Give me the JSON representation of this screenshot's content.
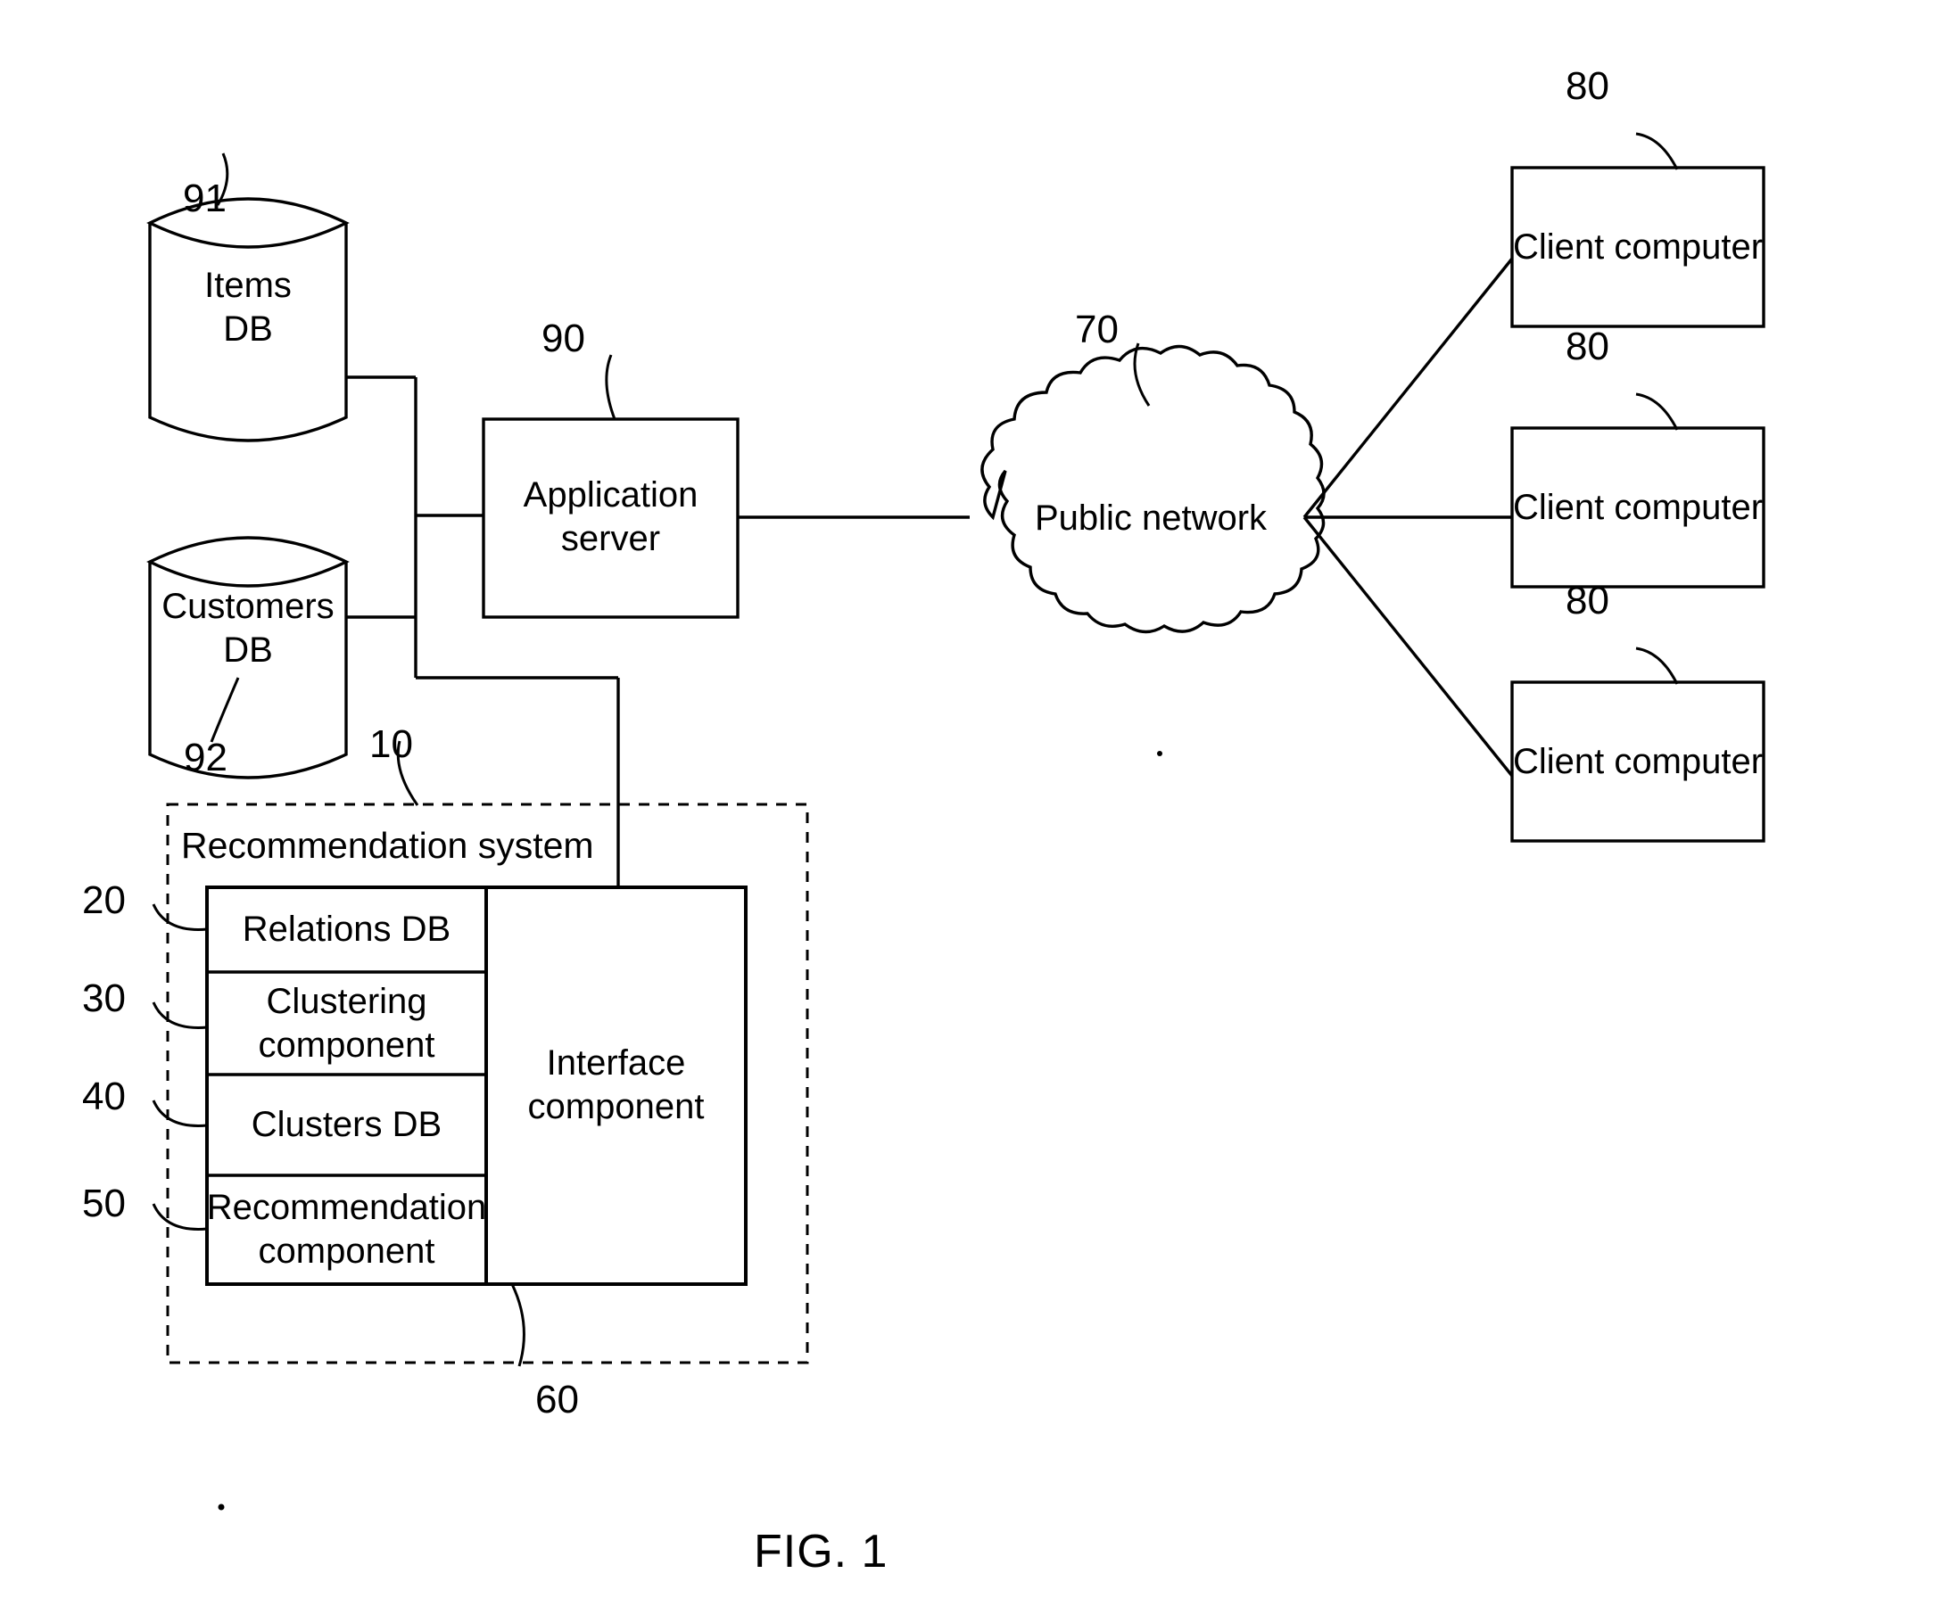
{
  "figure": {
    "caption": "FIG. 1",
    "title": "Recommendation system network architecture diagram"
  },
  "nodes": {
    "items_db": {
      "label_line1": "Items",
      "label_line2": "DB",
      "ref": "91",
      "shape": "cylinder"
    },
    "customers_db": {
      "label_line1": "Customers",
      "label_line2": "DB",
      "ref": "92",
      "shape": "cylinder"
    },
    "application_server": {
      "label_line1": "Application",
      "label_line2": "server",
      "ref": "90",
      "shape": "rect"
    },
    "public_network": {
      "label": "Public network",
      "ref": "70",
      "shape": "cloud"
    },
    "client_computers": [
      {
        "label": "Client computer",
        "ref": "80"
      },
      {
        "label": "Client computer",
        "ref": "80"
      },
      {
        "label": "Client computer",
        "ref": "80"
      }
    ],
    "recommendation_system": {
      "label": "Recommendation system",
      "ref": "10",
      "shape": "dashed-rect",
      "components": [
        {
          "label_line1": "Relations DB",
          "label_line2": "",
          "ref": "20"
        },
        {
          "label_line1": "Clustering",
          "label_line2": "component",
          "ref": "30"
        },
        {
          "label_line1": "Clusters DB",
          "label_line2": "",
          "ref": "40"
        },
        {
          "label_line1": "Recommendation",
          "label_line2": "component",
          "ref": "50"
        }
      ],
      "interface_component": {
        "label_line1": "Interface",
        "label_line2": "component",
        "ref": "60"
      }
    }
  },
  "colors": {
    "ink": "#000000",
    "paper": "#ffffff"
  }
}
